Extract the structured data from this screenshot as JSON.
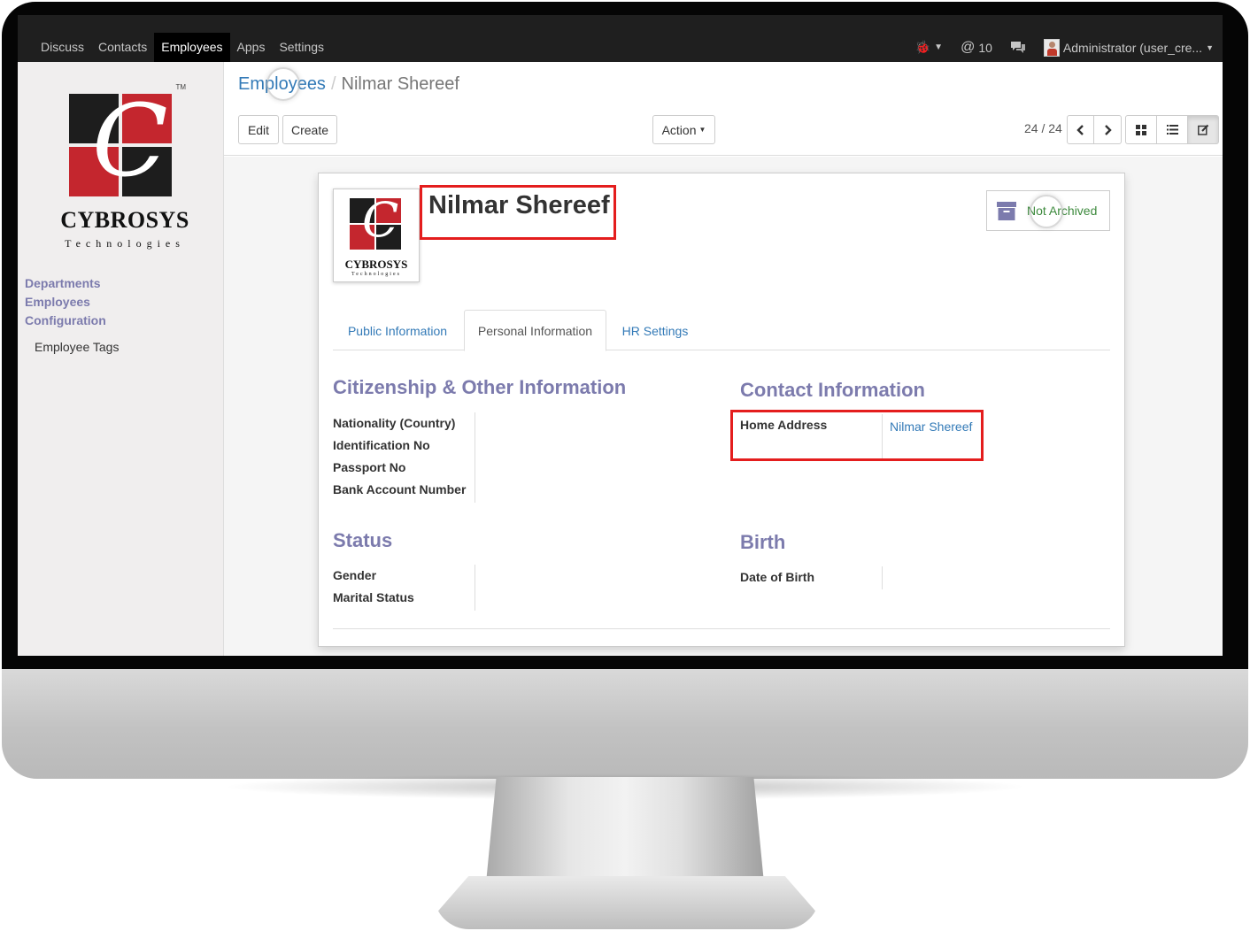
{
  "topbar": {
    "menu": [
      {
        "label": "Discuss",
        "active": false
      },
      {
        "label": "Contacts",
        "active": false
      },
      {
        "label": "Employees",
        "active": true
      },
      {
        "label": "Apps",
        "active": false
      },
      {
        "label": "Settings",
        "active": false
      }
    ],
    "mentions_count": "10",
    "user": "Administrator (user_cre..."
  },
  "sidebar": {
    "brand": "CYBROSYS",
    "brand_sub": "Technologies",
    "trademark": "TM",
    "items": [
      "Departments",
      "Employees",
      "Configuration"
    ],
    "sub_items": [
      "Employee Tags"
    ]
  },
  "breadcrumb": {
    "parent": "Employees",
    "current": "Nilmar Shereef"
  },
  "toolbar": {
    "edit_label": "Edit",
    "create_label": "Create",
    "action_label": "Action",
    "pager": "24 / 24"
  },
  "employee": {
    "name": "Nilmar Shereef",
    "archive_label": "Not Archived",
    "photo_brand": "CYBROSYS",
    "photo_sub": "Technologies"
  },
  "tabs": [
    {
      "label": "Public Information",
      "active": false
    },
    {
      "label": "Personal Information",
      "active": true
    },
    {
      "label": "HR Settings",
      "active": false
    }
  ],
  "sections": {
    "citizenship": {
      "title": "Citizenship & Other Information",
      "fields": [
        "Nationality (Country)",
        "Identification No",
        "Passport No",
        "Bank Account Number"
      ]
    },
    "contact": {
      "title": "Contact Information",
      "home_address_label": "Home Address",
      "home_address_value": "Nilmar Shereef"
    },
    "status": {
      "title": "Status",
      "fields": [
        "Gender",
        "Marital Status"
      ]
    },
    "birth": {
      "title": "Birth",
      "fields": [
        "Date of Birth"
      ]
    }
  },
  "colors": {
    "accent": "#7c7bad",
    "link": "#337ab7",
    "highlight": "#e41d1d",
    "logo_red": "#c4262e",
    "logo_dark": "#1d1d1d"
  }
}
